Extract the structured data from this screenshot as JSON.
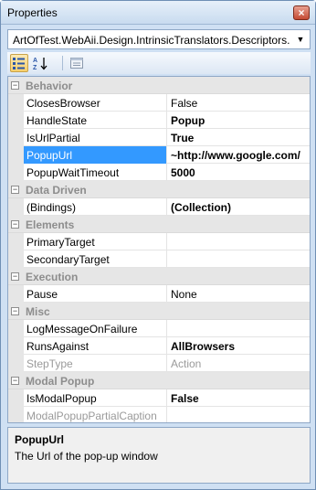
{
  "window": {
    "title": "Properties",
    "close_glyph": "×"
  },
  "object_selector": {
    "value": "ArtOfTest.WebAii.Design.IntrinsicTranslators.Descriptors.H",
    "arrow_icon": "chevron-down-icon"
  },
  "toolbar": {
    "buttons": [
      {
        "name": "categorized-icon",
        "active": true
      },
      {
        "name": "alphabetical-icon",
        "active": false
      },
      {
        "name": "property-pages-icon",
        "active": false
      }
    ]
  },
  "grid": {
    "rows": [
      {
        "kind": "category",
        "label": "Behavior",
        "toggle": "⊟"
      },
      {
        "kind": "property",
        "name": "ClosesBrowser",
        "value": "False",
        "bold": false,
        "disabled": false,
        "selected": false
      },
      {
        "kind": "property",
        "name": "HandleState",
        "value": "Popup",
        "bold": true,
        "disabled": false,
        "selected": false
      },
      {
        "kind": "property",
        "name": "IsUrlPartial",
        "value": "True",
        "bold": true,
        "disabled": false,
        "selected": false
      },
      {
        "kind": "property",
        "name": "PopupUrl",
        "value": "~http://www.google.com/",
        "bold": true,
        "disabled": false,
        "selected": true
      },
      {
        "kind": "property",
        "name": "PopupWaitTimeout",
        "value": "5000",
        "bold": true,
        "disabled": false,
        "selected": false
      },
      {
        "kind": "category",
        "label": "Data Driven",
        "toggle": "⊟"
      },
      {
        "kind": "property",
        "name": "(Bindings)",
        "value": "(Collection)",
        "bold": true,
        "disabled": false,
        "selected": false
      },
      {
        "kind": "category",
        "label": "Elements",
        "toggle": "⊟"
      },
      {
        "kind": "property",
        "name": "PrimaryTarget",
        "value": "",
        "bold": false,
        "disabled": false,
        "selected": false
      },
      {
        "kind": "property",
        "name": "SecondaryTarget",
        "value": "",
        "bold": false,
        "disabled": false,
        "selected": false
      },
      {
        "kind": "category",
        "label": "Execution",
        "toggle": "⊟"
      },
      {
        "kind": "property",
        "name": "Pause",
        "value": "None",
        "bold": false,
        "disabled": false,
        "selected": false
      },
      {
        "kind": "category",
        "label": "Misc",
        "toggle": "⊟"
      },
      {
        "kind": "property",
        "name": "LogMessageOnFailure",
        "value": "",
        "bold": false,
        "disabled": false,
        "selected": false
      },
      {
        "kind": "property",
        "name": "RunsAgainst",
        "value": "AllBrowsers",
        "bold": true,
        "disabled": false,
        "selected": false
      },
      {
        "kind": "property",
        "name": "StepType",
        "value": "Action",
        "bold": false,
        "disabled": true,
        "selected": false
      },
      {
        "kind": "category",
        "label": "Modal Popup",
        "toggle": "⊟"
      },
      {
        "kind": "property",
        "name": "IsModalPopup",
        "value": "False",
        "bold": true,
        "disabled": false,
        "selected": false
      },
      {
        "kind": "property",
        "name": "ModalPopupPartialCaption",
        "value": "",
        "bold": false,
        "disabled": true,
        "selected": false
      }
    ]
  },
  "description": {
    "title": "PopupUrl",
    "text": "The Url of the pop-up window"
  },
  "colors": {
    "selection": "#3399ff",
    "category_text": "#8d8d8d",
    "frame": "#cfe0f3"
  }
}
